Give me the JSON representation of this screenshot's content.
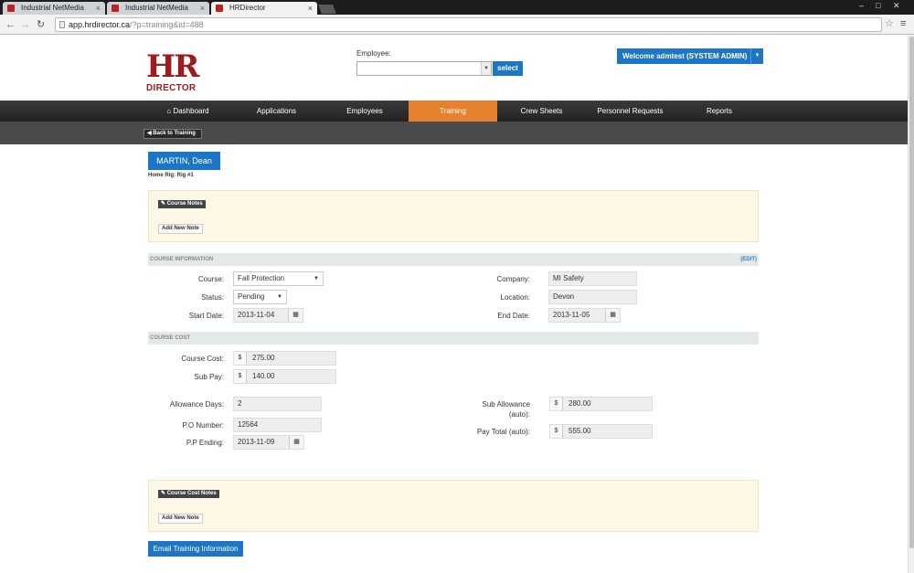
{
  "browser": {
    "tabs": [
      {
        "title": "Industrial NetMedia"
      },
      {
        "title": "Industrial NetMedia"
      },
      {
        "title": "HRDirector"
      }
    ],
    "url_host": "app.hrdirector.ca",
    "url_path": "/?p=training&id=488"
  },
  "header": {
    "logo_top": "HR",
    "logo_bottom": "DIRECTOR",
    "employee_label": "Employee:",
    "employee_value": "",
    "select_button": "select",
    "welcome_text": "Welcome admtest (SYSTEM ADMIN)"
  },
  "nav": {
    "items": [
      {
        "label": "Dashboard",
        "icon": "home-icon"
      },
      {
        "label": "Applications"
      },
      {
        "label": "Employees"
      },
      {
        "label": "Training"
      },
      {
        "label": "Crew Sheets"
      },
      {
        "label": "Personnel Requests"
      },
      {
        "label": "Reports"
      }
    ],
    "active": "Training",
    "active_color": "#e8812e"
  },
  "subnav": {
    "back_label": "Back to Training"
  },
  "employee": {
    "name": "MARTIN, Dean",
    "home_rig": "Home Rig: Rig #1"
  },
  "course_notes": {
    "badge": "Course Notes",
    "add_button": "Add New Note"
  },
  "course_info": {
    "heading": "COURSE INFORMATION",
    "edit_link": "(EDIT)",
    "course_label": "Course:",
    "course_value": "Fall Protection",
    "status_label": "Status:",
    "status_value": "Pending",
    "start_label": "Start Date:",
    "start_value": "2013-11-04",
    "company_label": "Company:",
    "company_value": "MI Safety",
    "location_label": "Location:",
    "location_value": "Devon",
    "end_label": "End Date:",
    "end_value": "2013-11-05"
  },
  "course_cost": {
    "heading": "COURSE COST",
    "currency": "$",
    "course_cost_label": "Course Cost:",
    "course_cost_value": "275.00",
    "sub_pay_label": "Sub Pay:",
    "sub_pay_value": "140.00",
    "allowance_days_label": "Allowance Days:",
    "allowance_days_value": "2",
    "po_label": "P.O Number:",
    "po_value": "12564",
    "pp_label": "P.P Ending:",
    "pp_value": "2013-11-09",
    "sub_allowance_label": "Sub Allowance",
    "sub_allowance_sub": "(auto):",
    "sub_allowance_value": "280.00",
    "pay_total_label": "Pay Total (auto):",
    "pay_total_value": "555.00"
  },
  "cost_notes": {
    "badge": "Course Cost Notes",
    "add_button": "Add New Note"
  },
  "email_button": "Email Training Information",
  "colors": {
    "primary": "#1c75c5",
    "brand": "#9b1b1e",
    "notes_bg": "#fdf8e6"
  }
}
